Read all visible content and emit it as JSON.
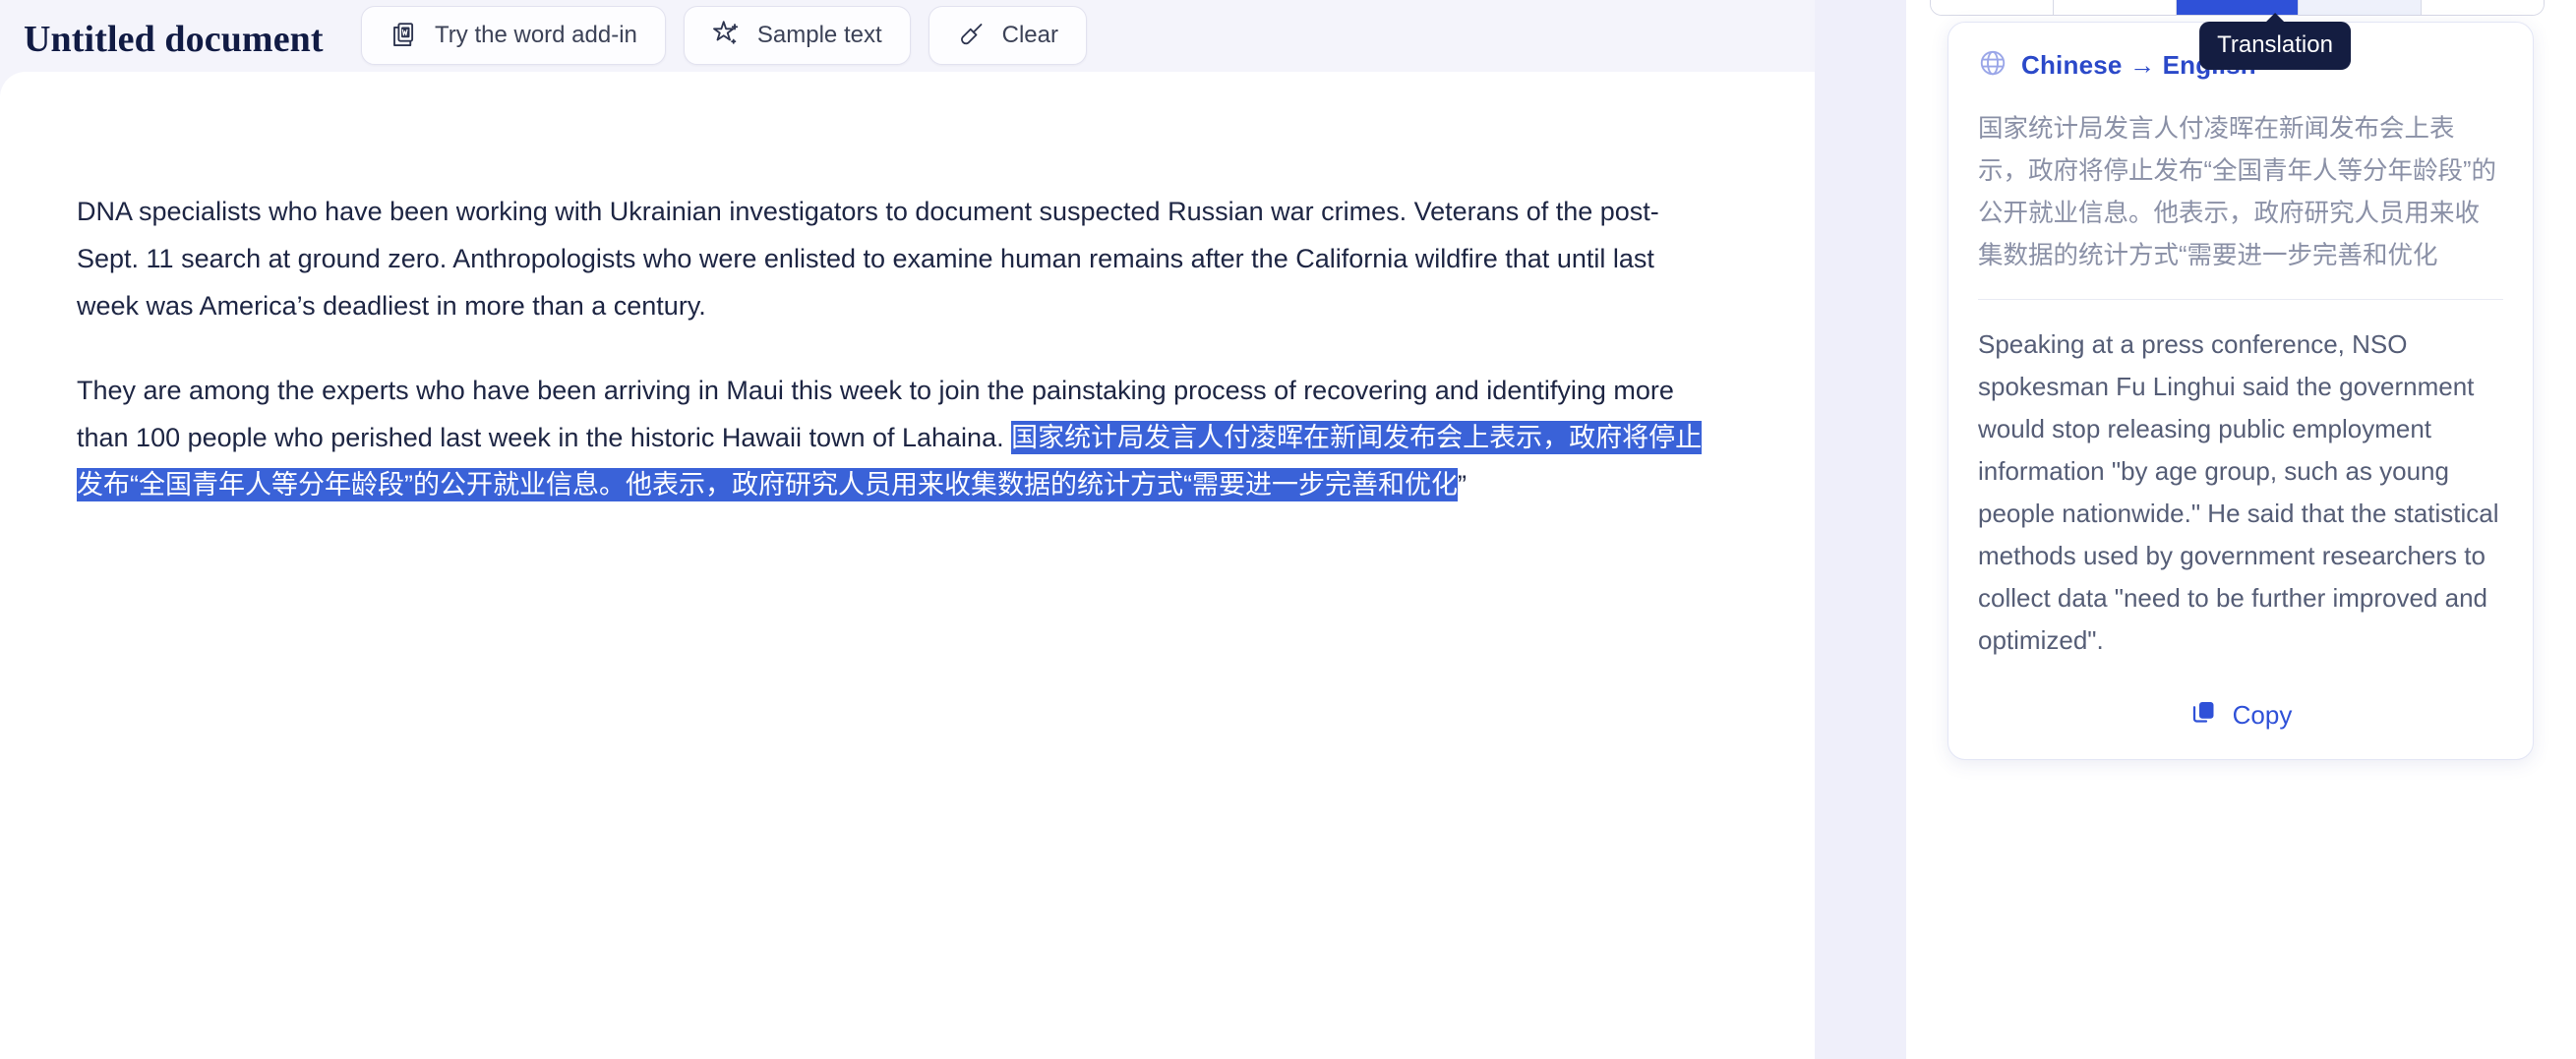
{
  "editor": {
    "title": "Untitled document",
    "toolbar": {
      "word_addin_label": "Try the word add-in",
      "sample_text_label": "Sample text",
      "clear_label": "Clear",
      "word_addin_icon": "word-document-icon",
      "sample_text_icon": "sparkle-star-icon",
      "clear_icon": "brush-wand-icon"
    },
    "paragraphs": [
      "DNA specialists who have been working with Ukrainian investigators to document suspected Russian war crimes. Veterans of the post-Sept. 11 search at ground zero. Anthropologists who were enlisted to examine human remains after the California wildfire that until last week was America’s deadliest in more than a century.",
      "They are among the experts who have been arriving in Maui this week to join the painstaking process of recovering and identifying more than 100 people who perished last week in the historic Hawaii town of Lahaina."
    ],
    "selected_text": "国家统计局发言人付凌晖在新闻发布会上表示，政府将停止发布“全国青年人等分年龄段”的公开就业信息。他表示，政府研究人员用来收集数据的统计方式“需要进一步完善和优化",
    "unselected_tail": "”"
  },
  "tooltip": {
    "label": "Translation"
  },
  "tab_strip": {
    "segments": [
      "",
      "",
      "",
      "",
      ""
    ],
    "active_index": 2
  },
  "translation_card": {
    "globe_icon": "globe-icon",
    "language_pair": "Chinese → English",
    "source_text": "国家统计局发言人付凌晖在新闻发布会上表示，政府将停止发布“全国青年人等分年龄段”的公开就业信息。他表示，政府研究人员用来收集数据的统计方式“需要进一步完善和优化",
    "translated_text": "Speaking at a press conference, NSO spokesman Fu Linghui said the government would stop releasing public employment information \"by age group, such as young people nationwide.\" He said that the statistical methods used by government researchers to collect data \"need to be further improved and optimized\".",
    "copy_label": "Copy",
    "copy_icon": "copy-icon"
  },
  "colors": {
    "page_background": "#f4f4fb",
    "gap_background": "#efeffa",
    "accent_blue": "#2f51d8",
    "selection_blue": "#3a62d8",
    "title_navy": "#111b44",
    "tooltip_navy": "#141d41"
  }
}
